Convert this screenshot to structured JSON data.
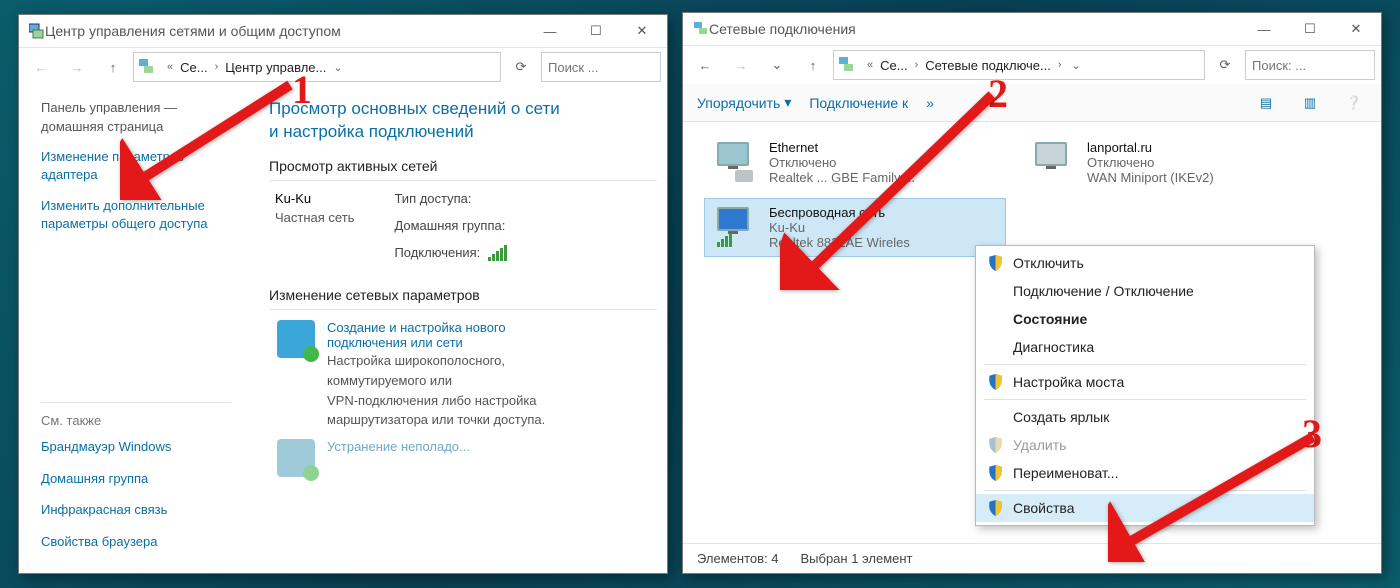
{
  "left_window": {
    "title": "Центр управления сетями и общим доступом",
    "breadcrumb": {
      "seg1": "Се...",
      "seg2": "Центр управле..."
    },
    "search_placeholder": "Поиск ...",
    "side": {
      "panel_home_l1": "Панель управления —",
      "panel_home_l2": "домашняя страница",
      "link_adapter": "Изменение параметров адаптера",
      "link_sharing_l1": "Изменить дополнительные",
      "link_sharing_l2": "параметры общего доступа",
      "see_also": "См. также",
      "aux1": "Брандмауэр Windows",
      "aux2": "Домашняя группа",
      "aux3": "Инфракрасная связь",
      "aux4": "Свойства браузера"
    },
    "main": {
      "heading_l1": "Просмотр основных сведений о сети",
      "heading_l2": "и настройка подключений",
      "sect_active": "Просмотр активных сетей",
      "net_name": "Ku-Ku",
      "net_type": "Частная сеть",
      "kv_access": "Тип доступа:",
      "kv_homegroup": "Домашняя группа:",
      "kv_connections": "Подключения:",
      "sect_change": "Изменение сетевых параметров",
      "wiz_link_l1": "Создание и настройка нового",
      "wiz_link_l2": "подключения или сети",
      "wiz_sub_l1": "Настройка широкополосного,",
      "wiz_sub_l2": "коммутируемого или",
      "wiz_sub_l3": "VPN-подключения либо настройка",
      "wiz_sub_l4": "маршрутизатора или точки доступа.",
      "wiz2_trouble": "Устранение неполадо..."
    }
  },
  "right_window": {
    "title": "Сетевые подключения",
    "breadcrumb": {
      "seg1": "Се...",
      "seg2": "Сетевые подключе..."
    },
    "search_placeholder": "Поиск: ...",
    "toolbar": {
      "organize": "Упорядочить",
      "connect": "Подключение к"
    },
    "adapters": [
      {
        "name": "Ethernet",
        "status": "Отключено",
        "device": "Realtek ... GBE Family ..."
      },
      {
        "name": "lanportal.ru",
        "status": "Отключено",
        "device": "WAN Miniport (IKEv2)"
      },
      {
        "name": "Беспроводная сеть",
        "status": "Ku-Ku",
        "device": "Realtek 8821AE Wireles"
      }
    ],
    "status": {
      "count": "Элементов: 4",
      "selected": "Выбран 1 элемент"
    },
    "ctx": {
      "disable": "Отключить",
      "connect": "Подключение / Отключение",
      "status": "Состояние",
      "diag": "Диагностика",
      "bridge": "Настройка моста",
      "shortcut": "Создать ярлык",
      "delete": "Удалить",
      "rename": "Переименоват...",
      "properties": "Свойства"
    }
  },
  "annotations": {
    "n1": "1",
    "n2": "2",
    "n3": "3"
  }
}
